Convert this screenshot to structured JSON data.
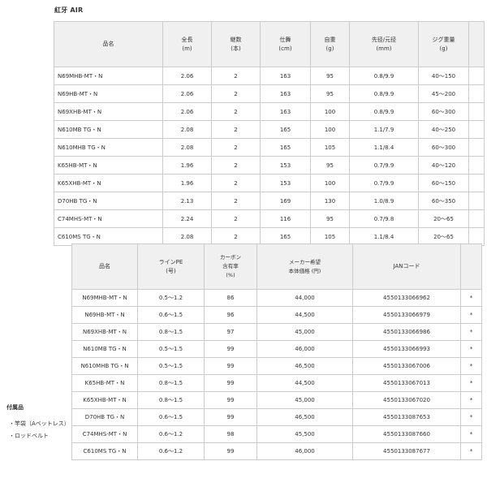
{
  "title": "紅牙 AIR",
  "table1": {
    "headers": [
      [
        "品名"
      ],
      [
        "全長",
        "(m)"
      ],
      [
        "継数",
        "(本)"
      ],
      [
        "仕舞",
        "(cm)"
      ],
      [
        "自重",
        "(g)"
      ],
      [
        "先径/元径",
        "(mm)"
      ],
      [
        "ジグ重量",
        "(g)"
      ]
    ],
    "rows": [
      [
        "N69MHB-MT・N",
        "2.06",
        "2",
        "163",
        "95",
        "0.8/9.9",
        "40〜150"
      ],
      [
        "N69HB-MT・N",
        "2.06",
        "2",
        "163",
        "95",
        "0.8/9.9",
        "45〜200"
      ],
      [
        "N69XHB-MT・N",
        "2.06",
        "2",
        "163",
        "100",
        "0.8/9.9",
        "60〜300"
      ],
      [
        "N610MB TG・N",
        "2.08",
        "2",
        "165",
        "100",
        "1.1/7.9",
        "40〜250"
      ],
      [
        "N610MHB TG・N",
        "2.08",
        "2",
        "165",
        "105",
        "1.1/8.4",
        "60〜300"
      ],
      [
        "K65HB-MT・N",
        "1.96",
        "2",
        "153",
        "95",
        "0.7/9.9",
        "40〜120"
      ],
      [
        "K65XHB-MT・N",
        "1.96",
        "2",
        "153",
        "100",
        "0.7/9.9",
        "60〜150"
      ],
      [
        "D70HB TG・N",
        "2.13",
        "2",
        "169",
        "130",
        "1.0/8.9",
        "60〜350"
      ],
      [
        "C74MHS-MT・N",
        "2.24",
        "2",
        "116",
        "95",
        "0.7/9.8",
        "20〜65"
      ],
      [
        "C610MS TG・N",
        "2.08",
        "2",
        "165",
        "105",
        "1.1/8.4",
        "20〜65"
      ]
    ]
  },
  "table2": {
    "headers": [
      [
        "品名"
      ],
      [
        "ラインPE",
        "(号)"
      ],
      [
        "カーボン",
        "含有率",
        "(%)"
      ],
      [
        "メーカー希望",
        "本体価格 (円)"
      ],
      [
        "JANコード"
      ],
      [
        ""
      ]
    ],
    "rows": [
      [
        "N69MHB-MT・N",
        "0.5〜1.2",
        "86",
        "44,000",
        "4550133066962",
        "*"
      ],
      [
        "N69HB-MT・N",
        "0.6〜1.5",
        "96",
        "44,500",
        "4550133066979",
        "*"
      ],
      [
        "N69XHB-MT・N",
        "0.8〜1.5",
        "97",
        "45,000",
        "4550133066986",
        "*"
      ],
      [
        "N610MB TG・N",
        "0.5〜1.5",
        "99",
        "46,000",
        "4550133066993",
        "*"
      ],
      [
        "N610MHB TG・N",
        "0.5〜1.5",
        "99",
        "46,500",
        "4550133067006",
        "*"
      ],
      [
        "K65HB-MT・N",
        "0.8〜1.5",
        "99",
        "44,500",
        "4550133067013",
        "*"
      ],
      [
        "K65XHB-MT・N",
        "0.8〜1.5",
        "99",
        "45,000",
        "4550133067020",
        "*"
      ],
      [
        "D70HB TG・N",
        "0.6〜1.5",
        "99",
        "46,500",
        "4550133087653",
        "*"
      ],
      [
        "C74MHS-MT・N",
        "0.6〜1.2",
        "98",
        "45,500",
        "4550133087660",
        "*"
      ],
      [
        "C610MS TG・N",
        "0.6〜1.2",
        "99",
        "46,000",
        "4550133087677",
        "*"
      ]
    ]
  },
  "accessories": {
    "title": "付属品",
    "items": [
      "・竿袋（Aベットレス）",
      "・ロッドベルト"
    ]
  }
}
